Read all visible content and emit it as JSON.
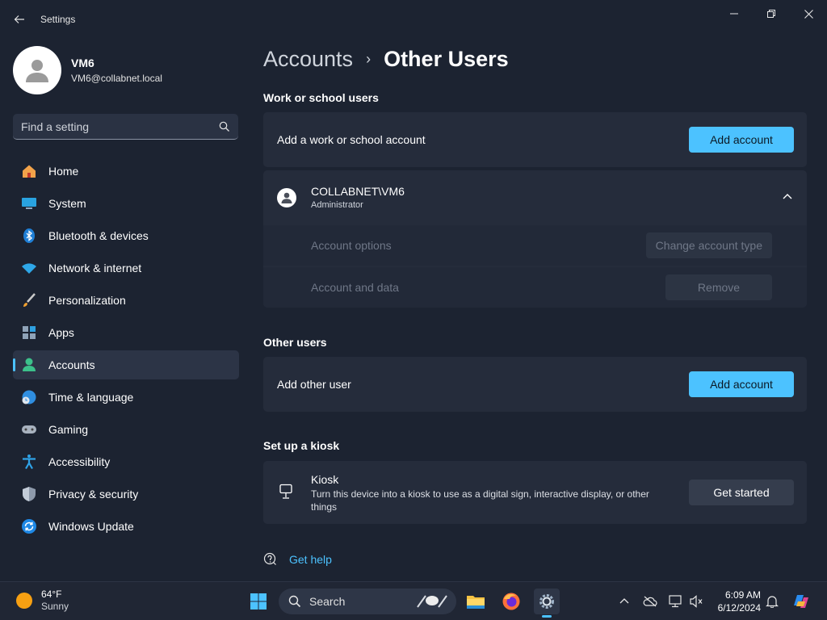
{
  "window": {
    "title": "Settings"
  },
  "profile": {
    "name": "VM6",
    "email": "VM6@collabnet.local"
  },
  "search": {
    "placeholder": "Find a setting"
  },
  "nav": {
    "items": [
      {
        "label": "Home",
        "icon": "home-icon"
      },
      {
        "label": "System",
        "icon": "monitor-icon"
      },
      {
        "label": "Bluetooth & devices",
        "icon": "bluetooth-icon"
      },
      {
        "label": "Network & internet",
        "icon": "wifi-icon"
      },
      {
        "label": "Personalization",
        "icon": "brush-icon"
      },
      {
        "label": "Apps",
        "icon": "apps-icon"
      },
      {
        "label": "Accounts",
        "icon": "person-icon",
        "active": true
      },
      {
        "label": "Time & language",
        "icon": "globe-clock-icon"
      },
      {
        "label": "Gaming",
        "icon": "gamepad-icon"
      },
      {
        "label": "Accessibility",
        "icon": "accessibility-icon"
      },
      {
        "label": "Privacy & security",
        "icon": "shield-icon"
      },
      {
        "label": "Windows Update",
        "icon": "update-icon"
      }
    ]
  },
  "breadcrumb": {
    "parent": "Accounts",
    "separator": "›",
    "current": "Other Users"
  },
  "work_school": {
    "title": "Work or school users",
    "add_label": "Add a work or school account",
    "add_button": "Add account",
    "user": {
      "name": "COLLABNET\\VM6",
      "role": "Administrator",
      "options_label": "Account options",
      "change_type_button": "Change account type",
      "data_label": "Account and data",
      "remove_button": "Remove"
    }
  },
  "other_users": {
    "title": "Other users",
    "add_label": "Add other user",
    "add_button": "Add account"
  },
  "kiosk": {
    "title": "Set up a kiosk",
    "card_title": "Kiosk",
    "description": "Turn this device into a kiosk to use as a digital sign, interactive display, or other things",
    "button": "Get started"
  },
  "help": {
    "label": "Get help"
  },
  "taskbar": {
    "weather_temp": "64°F",
    "weather_desc": "Sunny",
    "search_label": "Search",
    "time": "6:09 AM",
    "date": "6/12/2024"
  },
  "colors": {
    "accent": "#4cc2ff",
    "background": "#1c2331",
    "card": "#252c3b"
  }
}
